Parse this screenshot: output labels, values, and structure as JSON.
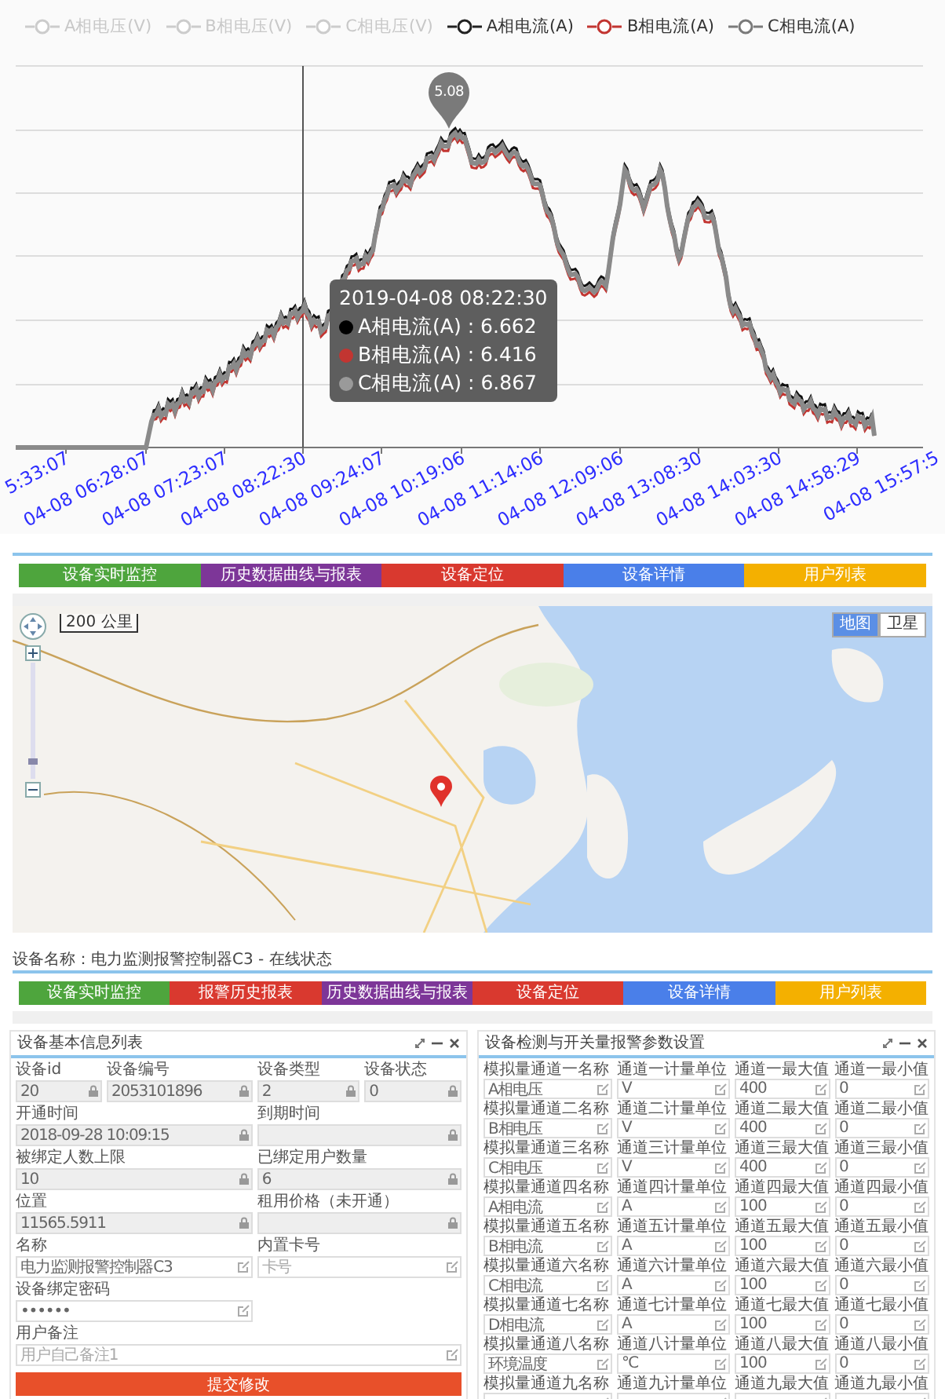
{
  "chart": {
    "legend": [
      {
        "label": "A相电压(V)",
        "on": false
      },
      {
        "label": "B相电压(V)",
        "on": false
      },
      {
        "label": "C相电压(V)",
        "on": false
      },
      {
        "label": "A相电流(A)",
        "on": true,
        "color": "#222222"
      },
      {
        "label": "B相电流(A)",
        "on": true,
        "color": "#c23531"
      },
      {
        "label": "C相电流(A)",
        "on": true,
        "color": "#7a7a7a"
      }
    ],
    "max_pin": "5.08",
    "x_labels": [
      "5:33:07",
      "04-08 06:28:07",
      "04-08 07:23:07",
      "04-08 08:22:30",
      "04-08 09:24:07",
      "04-08 10:19:06",
      "04-08 11:14:06",
      "04-08 12:09:06",
      "04-08 13:08:30",
      "04-08 14:03:30",
      "04-08 14:58:29",
      "04-08 15:57:5"
    ],
    "tooltip": {
      "time": "2019-04-08 08:22:30",
      "rows": [
        {
          "label": "A相电流(A) : 6.662",
          "color": "#000000"
        },
        {
          "label": "B相电流(A) : 6.416",
          "color": "#c23531"
        },
        {
          "label": "C相电流(A) : 6.867",
          "color": "#9a9a9a"
        }
      ]
    }
  },
  "top_tabs": [
    {
      "label": "设备实时监控",
      "color": "#4ea53d"
    },
    {
      "label": "历史数据曲线与报表",
      "color": "#7d3698"
    },
    {
      "label": "设备定位",
      "color": "#d9392f"
    },
    {
      "label": "设备详情",
      "color": "#4a7fe9"
    },
    {
      "label": "用户列表",
      "color": "#f4b000"
    }
  ],
  "map": {
    "scale": "200 公里",
    "zoom": {
      "level": 0.15
    },
    "map_types": [
      {
        "label": "地图",
        "selected": true
      },
      {
        "label": "卫星",
        "selected": false
      }
    ]
  },
  "device_line": "设备名称：电力监测报警控制器C3 - 在线状态",
  "device_tabs": [
    {
      "label": "设备实时监控",
      "color": "#4ea53d"
    },
    {
      "label": "报警历史报表",
      "color": "#d9392f"
    },
    {
      "label": "历史数据曲线与报表",
      "color": "#7d3698"
    },
    {
      "label": "设备定位",
      "color": "#d9392f"
    },
    {
      "label": "设备详情",
      "color": "#4a7fe9"
    },
    {
      "label": "用户列表",
      "color": "#f4b000"
    }
  ],
  "info_panel": {
    "title": "设备基本信息列表",
    "rows": [
      [
        {
          "label": "设备id",
          "value": "20",
          "locked": true
        },
        {
          "label": "设备编号",
          "value": "2053101896",
          "locked": true
        },
        {
          "label": "设备类型",
          "value": "2",
          "locked": true
        },
        {
          "label": "设备状态",
          "value": "0",
          "locked": true
        }
      ],
      [
        {
          "label": "开通时间",
          "value": "2018-09-28 10:09:15",
          "locked": true
        },
        {
          "label": "到期时间",
          "locked": true
        }
      ],
      [
        {
          "label": "被绑定人数上限",
          "value": "10",
          "locked": true
        },
        {
          "label": "已绑定用户数量",
          "value": "6",
          "locked": true
        }
      ],
      [
        {
          "label": "位置",
          "value": "11565.5911",
          "locked": true
        },
        {
          "label": "租用价格（未开通）",
          "locked": true
        }
      ],
      [
        {
          "label": "名称",
          "value": "电力监测报警控制器C3",
          "locked": false
        },
        {
          "label": "内置卡号",
          "placeholder": "卡号",
          "locked": false
        }
      ],
      [
        {
          "label": "设备绑定密码",
          "value": "••••••",
          "locked": false
        }
      ],
      [
        {
          "label": "用户备注",
          "placeholder": "用户自己备注1",
          "locked": false,
          "wide": true
        }
      ]
    ],
    "submit": "提交修改"
  },
  "param_panel": {
    "title": "设备检测与开关量报警参数设置",
    "rows": [
      [
        {
          "label": "模拟量通道一名称",
          "value": "A相电压"
        },
        {
          "label": "通道一计量单位",
          "value": "V"
        },
        {
          "label": "通道一最大值",
          "value": "400"
        },
        {
          "label": "通道一最小值",
          "value": "0"
        }
      ],
      [
        {
          "label": "模拟量通道二名称",
          "value": "B相电压"
        },
        {
          "label": "通道二计量单位",
          "value": "V"
        },
        {
          "label": "通道二最大值",
          "value": "400"
        },
        {
          "label": "通道二最小值",
          "value": "0"
        }
      ],
      [
        {
          "label": "模拟量通道三名称",
          "value": "C相电压"
        },
        {
          "label": "通道三计量单位",
          "value": "V"
        },
        {
          "label": "通道三最大值",
          "value": "400"
        },
        {
          "label": "通道三最小值",
          "value": "0"
        }
      ],
      [
        {
          "label": "模拟量通道四名称",
          "value": "A相电流"
        },
        {
          "label": "通道四计量单位",
          "value": "A"
        },
        {
          "label": "通道四最大值",
          "value": "100"
        },
        {
          "label": "通道四最小值",
          "value": "0"
        }
      ],
      [
        {
          "label": "模拟量通道五名称",
          "value": "B相电流"
        },
        {
          "label": "通道五计量单位",
          "value": "A"
        },
        {
          "label": "通道五最大值",
          "value": "100"
        },
        {
          "label": "通道五最小值",
          "value": "0"
        }
      ],
      [
        {
          "label": "模拟量通道六名称",
          "value": "C相电流"
        },
        {
          "label": "通道六计量单位",
          "value": "A"
        },
        {
          "label": "通道六最大值",
          "value": "100"
        },
        {
          "label": "通道六最小值",
          "value": "0"
        }
      ],
      [
        {
          "label": "模拟量通道七名称",
          "value": "D相电流"
        },
        {
          "label": "通道七计量单位",
          "value": "A"
        },
        {
          "label": "通道七最大值",
          "value": "100"
        },
        {
          "label": "通道七最小值",
          "value": "0"
        }
      ],
      [
        {
          "label": "模拟量通道八名称",
          "value": "环境温度"
        },
        {
          "label": "通道八计量单位",
          "value": "℃"
        },
        {
          "label": "通道八最大值",
          "value": "100"
        },
        {
          "label": "通道八最小值",
          "value": "0"
        }
      ],
      [
        {
          "label": "模拟量通道九名称"
        },
        {
          "label": "通道九计量单位"
        },
        {
          "label": "通道九最大值"
        },
        {
          "label": "通道九最小值"
        }
      ]
    ]
  }
}
